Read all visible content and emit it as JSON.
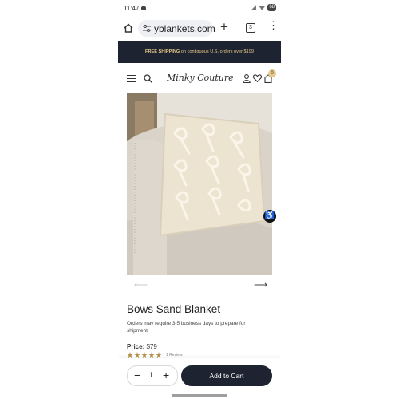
{
  "status_bar": {
    "time": "11:47",
    "battery": "68"
  },
  "browser": {
    "url": "yblankets.com",
    "tab_count": "3"
  },
  "promo": {
    "bold": "FREE SHIPPING",
    "rest": " on contiguous U.S. orders over $199"
  },
  "header": {
    "logo": "Minky Couture",
    "cart_count": "0"
  },
  "product": {
    "title": "Bows Sand Blanket",
    "note": "Orders may require 3-5 business days to prepare for shipment.",
    "price_label": "Price:",
    "price_value": "$79",
    "rating": 5,
    "reviews": "1 Review"
  },
  "cart_bar": {
    "quantity": "1",
    "add_to_cart": "Add to Cart"
  },
  "colors": {
    "navy": "#1d2330",
    "gold": "#e7c98b",
    "star": "#b5914a"
  }
}
